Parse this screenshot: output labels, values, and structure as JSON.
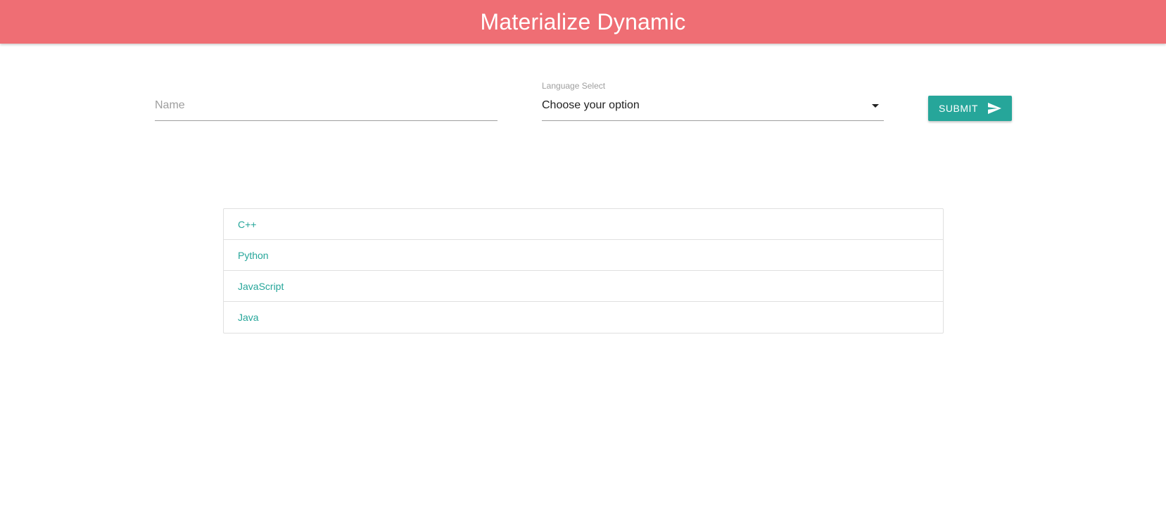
{
  "header": {
    "title": "Materialize Dynamic",
    "background_color": "#ef6e74"
  },
  "form": {
    "name_placeholder": "Name",
    "name_value": "",
    "select_label": "Language Select",
    "select_value": "Choose your option",
    "submit_label": "SUBMIT",
    "submit_icon": "send-icon",
    "accent_color": "#26a69a"
  },
  "languages": {
    "items": [
      {
        "label": "C++"
      },
      {
        "label": "Python"
      },
      {
        "label": "JavaScript"
      },
      {
        "label": "Java"
      }
    ]
  }
}
